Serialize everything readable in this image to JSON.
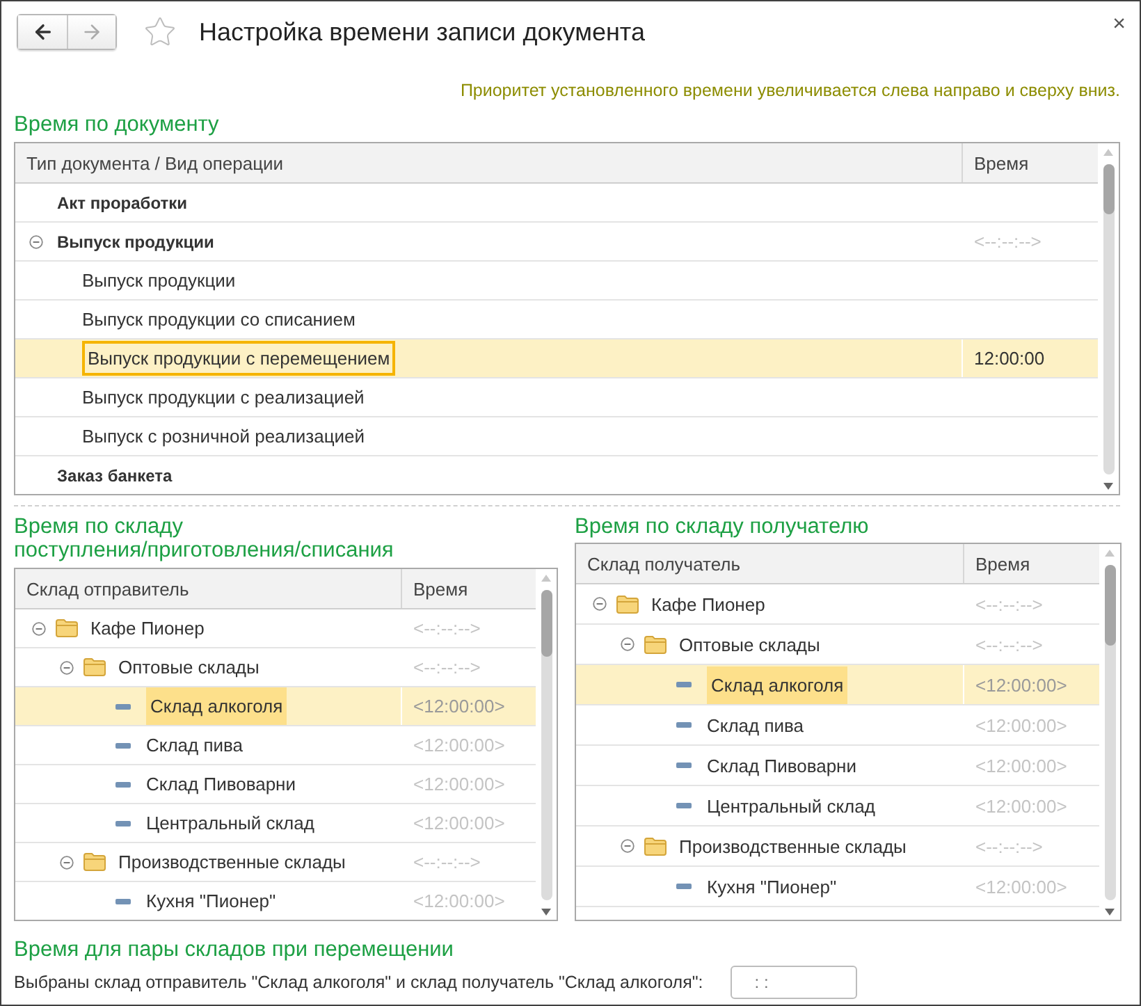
{
  "window": {
    "title": "Настройка времени записи документа",
    "close": "×"
  },
  "hint": "Приоритет установленного времени увеличивается слева направо и сверху вниз.",
  "document_section": {
    "title": "Время по документу",
    "columns": [
      "Тип документа / Вид операции",
      "Время"
    ],
    "rows": [
      {
        "name": "Акт проработки",
        "kind": "group",
        "selected": false
      },
      {
        "name": "Выпуск продукции",
        "kind": "group",
        "expanded": true,
        "time": "<--:--:-->",
        "time_muted": true,
        "selected": false,
        "children": [
          {
            "name": "Выпуск продукции",
            "kind": "operation",
            "selected": false
          },
          {
            "name": "Выпуск продукции со списанием",
            "kind": "operation",
            "selected": false
          },
          {
            "name": "Выпуск продукции с перемещением",
            "kind": "operation",
            "time": "12:00:00",
            "time_muted": false,
            "selected": true
          },
          {
            "name": "Выпуск продукции с реализацией",
            "kind": "operation",
            "selected": false
          },
          {
            "name": "Выпуск с розничной реализацией",
            "kind": "operation",
            "selected": false
          }
        ]
      },
      {
        "name": "Заказ банкета",
        "kind": "group",
        "selected": false
      }
    ]
  },
  "sender_section": {
    "title": "Время по складу поступления/приготовления/списания",
    "columns": [
      "Склад отправитель",
      "Время"
    ],
    "rows": [
      {
        "name": "Кафе Пионер",
        "kind": "folder",
        "expanded": true,
        "time": "<--:--:-->",
        "time_muted": true,
        "selected": false,
        "children": [
          {
            "name": "Оптовые склады",
            "kind": "folder",
            "expanded": true,
            "time": "<--:--:-->",
            "time_muted": true,
            "selected": false,
            "children": [
              {
                "name": "Склад алкоголя",
                "kind": "warehouse",
                "time": "<12:00:00>",
                "time_muted": true,
                "selected": true
              },
              {
                "name": "Склад пива",
                "kind": "warehouse",
                "time": "<12:00:00>",
                "time_muted": true,
                "selected": false
              },
              {
                "name": "Склад Пивоварни",
                "kind": "warehouse",
                "time": "<12:00:00>",
                "time_muted": true,
                "selected": false
              },
              {
                "name": "Центральный склад",
                "kind": "warehouse",
                "time": "<12:00:00>",
                "time_muted": true,
                "selected": false
              }
            ]
          },
          {
            "name": "Производственные склады",
            "kind": "folder",
            "expanded": true,
            "time": "<--:--:-->",
            "time_muted": true,
            "selected": false,
            "children": [
              {
                "name": "Кухня \"Пионер\"",
                "kind": "warehouse",
                "time": "<12:00:00>",
                "time_muted": true,
                "selected": false
              }
            ]
          }
        ]
      }
    ]
  },
  "receiver_section": {
    "title": "Время по складу получателю",
    "columns": [
      "Склад получатель",
      "Время"
    ],
    "rows": [
      {
        "name": "Кафе Пионер",
        "kind": "folder",
        "expanded": true,
        "time": "<--:--:-->",
        "time_muted": true,
        "selected": false,
        "children": [
          {
            "name": "Оптовые склады",
            "kind": "folder",
            "expanded": true,
            "time": "<--:--:-->",
            "time_muted": true,
            "selected": false,
            "children": [
              {
                "name": "Склад алкоголя",
                "kind": "warehouse",
                "time": "<12:00:00>",
                "time_muted": true,
                "selected": true
              },
              {
                "name": "Склад пива",
                "kind": "warehouse",
                "time": "<12:00:00>",
                "time_muted": true,
                "selected": false
              },
              {
                "name": "Склад Пивоварни",
                "kind": "warehouse",
                "time": "<12:00:00>",
                "time_muted": true,
                "selected": false
              },
              {
                "name": "Центральный склад",
                "kind": "warehouse",
                "time": "<12:00:00>",
                "time_muted": true,
                "selected": false
              }
            ]
          },
          {
            "name": "Производственные склады",
            "kind": "folder",
            "expanded": true,
            "time": "<--:--:-->",
            "time_muted": true,
            "selected": false,
            "children": [
              {
                "name": "Кухня \"Пионер\"",
                "kind": "warehouse",
                "time": "<12:00:00>",
                "time_muted": true,
                "selected": false
              }
            ]
          }
        ]
      }
    ]
  },
  "pair_section": {
    "title": "Время для пары складов при перемещении",
    "text": "Выбраны склад отправитель \"Склад алкоголя\" и склад получатель \"Склад алкоголя\":",
    "field_value": ": :"
  }
}
